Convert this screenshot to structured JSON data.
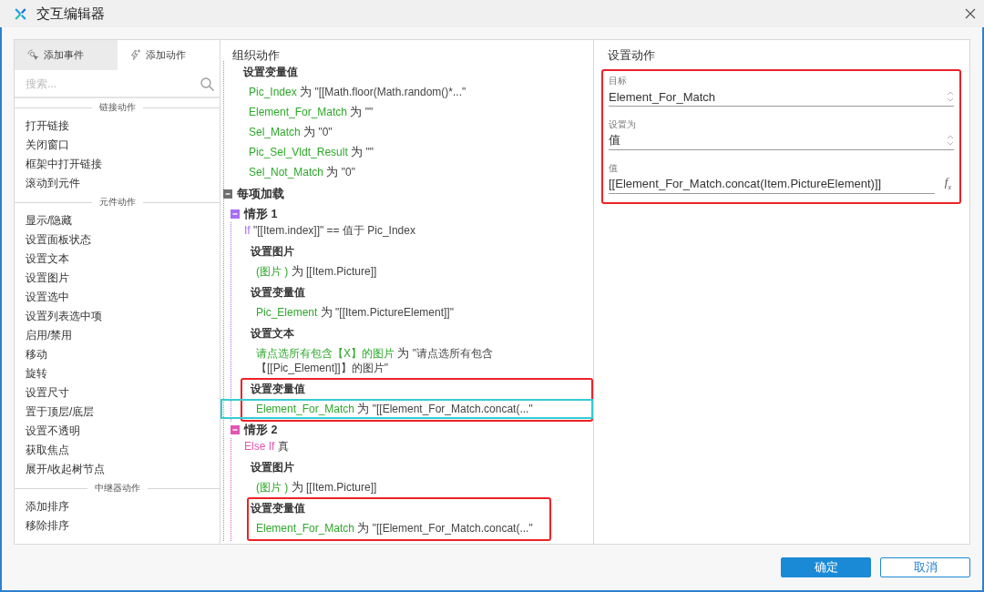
{
  "window": {
    "title": "交互编辑器"
  },
  "left_panel": {
    "tabs": [
      {
        "label": "添加事件",
        "selected": false
      },
      {
        "label": "添加动作",
        "selected": true
      }
    ],
    "search": {
      "placeholder": "搜索..."
    },
    "groups": [
      {
        "title": "链接动作",
        "items": [
          "打开链接",
          "关闭窗口",
          "框架中打开链接",
          "滚动到元件"
        ]
      },
      {
        "title": "元件动作",
        "items": [
          "显示/隐藏",
          "设置面板状态",
          "设置文本",
          "设置图片",
          "设置选中",
          "设置列表选中项",
          "启用/禁用",
          "移动",
          "旋转",
          "设置尺寸",
          "置于顶层/底层",
          "设置不透明",
          "获取焦点",
          "展开/收起树节点"
        ]
      },
      {
        "title": "中继器动作",
        "items": [
          "添加排序",
          "移除排序"
        ]
      }
    ]
  },
  "middle_panel": {
    "title": "组织动作",
    "tree": [
      {
        "kind": "action",
        "title": "设置变量值",
        "annotated": false,
        "children": [
          {
            "kind": "assignment",
            "target": "Pic_Index",
            "op": "为",
            "value": "\"[[Math.floor(Math.random()*...\"",
            "selected": false
          },
          {
            "kind": "assignment",
            "target": "Element_For_Match",
            "op": "为",
            "value": "\"\"",
            "selected": false
          },
          {
            "kind": "assignment",
            "target": "Sel_Match",
            "op": "为",
            "value": "\"0\"",
            "selected": false
          },
          {
            "kind": "assignment",
            "target": "Pic_Sel_Vldt_Result",
            "op": "为",
            "value": "\"\"",
            "selected": false
          },
          {
            "kind": "assignment",
            "target": "Sel_Not_Match",
            "op": "为",
            "value": "\"0\"",
            "selected": false
          }
        ]
      },
      {
        "kind": "event",
        "title": "每项加载",
        "expanded": true,
        "children": [
          {
            "kind": "case",
            "title": "情形 1",
            "color": "#a66ef5",
            "expanded": true,
            "condition": {
              "keyword": "If",
              "text": "\"[[Item.index]]\" == 值于 Pic_Index"
            },
            "children": [
              {
                "kind": "action",
                "title": "设置图片",
                "annotated": false,
                "children": [
                  {
                    "kind": "assignment",
                    "target": "(图片 )",
                    "op": "为",
                    "value": "[[Item.Picture]]",
                    "selected": false
                  }
                ]
              },
              {
                "kind": "action",
                "title": "设置变量值",
                "annotated": false,
                "children": [
                  {
                    "kind": "assignment",
                    "target": "Pic_Element",
                    "op": "为",
                    "value": "\"[[Item.PictureElement]]\"",
                    "selected": false
                  }
                ]
              },
              {
                "kind": "action",
                "title": "设置文本",
                "annotated": false,
                "children": [
                  {
                    "kind": "assignment",
                    "target": "请点选所有包含【X】的图片",
                    "op": "为",
                    "value": "\"请点选所有包含【[[Pic_Element]]】的图片\"",
                    "selected": false
                  }
                ]
              },
              {
                "kind": "action",
                "title": "设置变量值",
                "annotated": true,
                "children": [
                  {
                    "kind": "assignment",
                    "target": "Element_For_Match",
                    "op": "为",
                    "value": "\"[[Element_For_Match.concat(...\"",
                    "selected": true
                  }
                ]
              }
            ]
          },
          {
            "kind": "case",
            "title": "情形 2",
            "color": "#e255b3",
            "expanded": true,
            "condition": {
              "keyword": "Else If",
              "text": "真"
            },
            "children": [
              {
                "kind": "action",
                "title": "设置图片",
                "annotated": false,
                "children": [
                  {
                    "kind": "assignment",
                    "target": "(图片 )",
                    "op": "为",
                    "value": "[[Item.Picture]]",
                    "selected": false
                  }
                ]
              },
              {
                "kind": "action",
                "title": "设置变量值",
                "annotated": true,
                "children": [
                  {
                    "kind": "assignment",
                    "target": "Element_For_Match",
                    "op": "为",
                    "value": "\"[[Element_For_Match.concat(...\"",
                    "selected": false
                  }
                ]
              }
            ]
          }
        ]
      }
    ]
  },
  "right_panel": {
    "title": "设置动作",
    "annotated": true,
    "fields": [
      {
        "kind": "select",
        "label": "目标",
        "value": "Element_For_Match"
      },
      {
        "kind": "select",
        "label": "设置为",
        "value": "值"
      },
      {
        "kind": "expression",
        "label": "值",
        "value": "[[Element_For_Match.concat(Item.PictureElement)]]",
        "button": "f$_{x}$"
      }
    ]
  },
  "buttons": [
    {
      "kind": "primary",
      "label": "确定"
    },
    {
      "kind": "secondary",
      "label": "取消"
    }
  ]
}
